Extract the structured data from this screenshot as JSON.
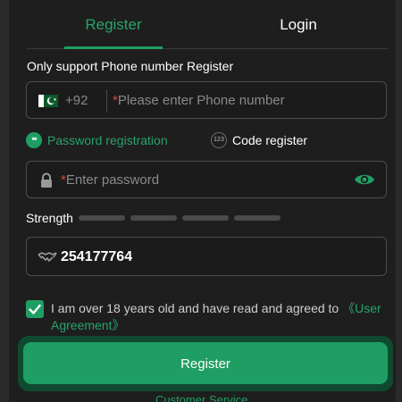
{
  "tabs": {
    "register": "Register",
    "login": "Login"
  },
  "hint": "Only support Phone number Register",
  "phone": {
    "dial_code": "+92",
    "required_mark": "*",
    "placeholder": "Please enter Phone number"
  },
  "options": {
    "password_registration": "Password registration",
    "code_register": "Code register",
    "password_icon_text": "**",
    "code_icon_text": "123"
  },
  "password": {
    "required_mark": "*",
    "placeholder": "Enter password"
  },
  "strength": {
    "label": "Strength",
    "filled_segments": 0,
    "total_segments": 4
  },
  "code": {
    "value": "254177764"
  },
  "agreement": {
    "checked": true,
    "text": "I am over 18 years old and have read and agreed to ",
    "link": "《User Agreement》"
  },
  "register_button": "Register",
  "customer_service": "Customer Service",
  "colors": {
    "accent": "#1f9e63",
    "background": "#1e1e1e",
    "required": "#e0453c"
  }
}
